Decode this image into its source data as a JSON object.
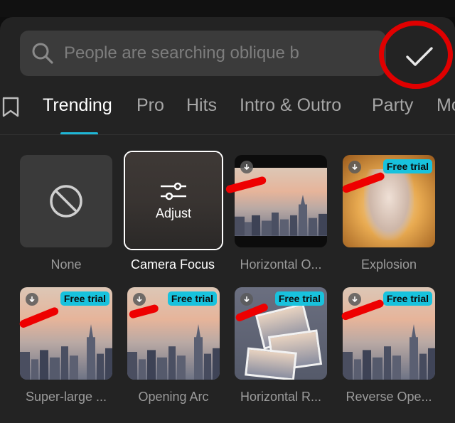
{
  "search": {
    "placeholder": "People are searching oblique b"
  },
  "tabs": [
    {
      "label": "Trending",
      "active": true
    },
    {
      "label": "Pro"
    },
    {
      "label": "Hits"
    },
    {
      "label": "Intro & Outro"
    },
    {
      "label": "Party"
    },
    {
      "label": "Mo"
    }
  ],
  "effects": [
    {
      "label": "None",
      "thumb": "none"
    },
    {
      "label": "Camera Focus",
      "thumb": "adjust",
      "overlay": "Adjust",
      "selected": true
    },
    {
      "label": "Horizontal O...",
      "thumb": "city",
      "download": true
    },
    {
      "label": "Explosion",
      "thumb": "fire",
      "badge": "Free trial",
      "download": true
    },
    {
      "label": "Super-large ...",
      "thumb": "city",
      "badge": "Free trial",
      "download": true
    },
    {
      "label": "Opening Arc",
      "thumb": "city",
      "badge": "Free trial",
      "download": true
    },
    {
      "label": "Horizontal R...",
      "thumb": "cards",
      "badge": "Free trial",
      "download": true
    },
    {
      "label": "Reverse Ope...",
      "thumb": "city",
      "badge": "Free trial",
      "download": true
    }
  ],
  "colors": {
    "accent": "#1fb6d6",
    "badge": "#18c2dd",
    "annotation_red": "#ee0000"
  }
}
